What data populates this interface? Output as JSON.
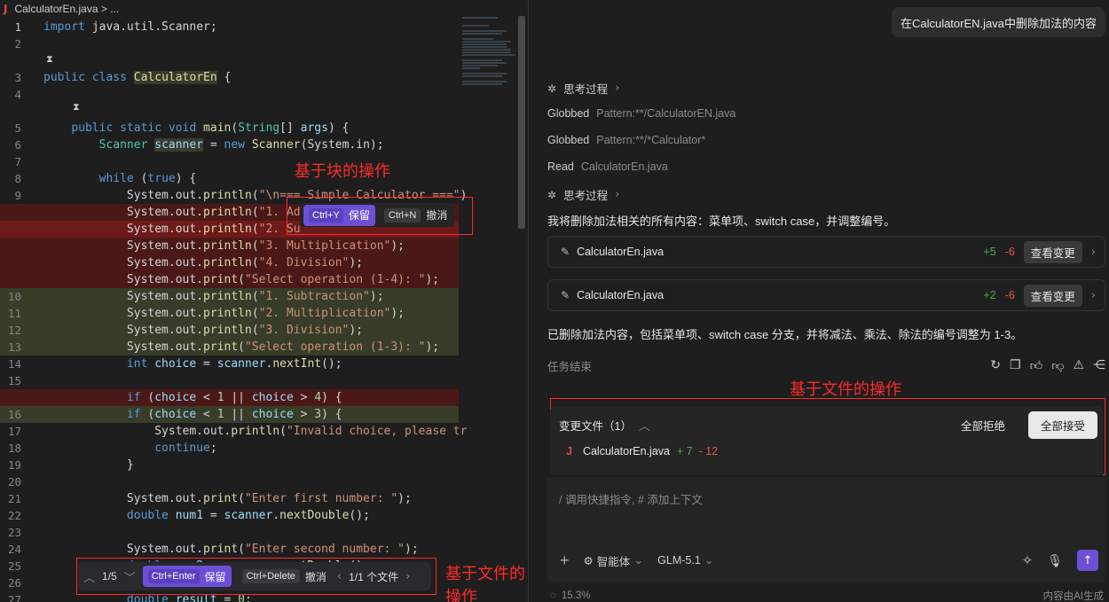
{
  "tab": {
    "icon": "J",
    "title": "CalculatorEn.java > ..."
  },
  "code": {
    "lines": [
      {
        "n": "1",
        "cls": "",
        "html": "<span class='kw'>import</span> java.util.Scanner;"
      },
      {
        "n": "2",
        "cls": "",
        "html": ""
      },
      {
        "n": "",
        "cls": "",
        "html": ""
      },
      {
        "n": "3",
        "cls": "",
        "html": "<span class='kw'>public</span> <span class='kw'>class</span> <span class='cls'>CalculatorEn</span> {"
      },
      {
        "n": "4",
        "cls": "",
        "html": ""
      },
      {
        "n": "",
        "cls": "",
        "html": ""
      },
      {
        "n": "5",
        "cls": "",
        "html": "    <span class='kw'>public</span> <span class='kw'>static</span> <span class='kw'>void</span> <span class='fn'>main</span>(<span class='ty'>String</span>[] <span class='var'>args</span>) {"
      },
      {
        "n": "6",
        "cls": "",
        "html": "        <span class='ty'>Scanner</span> <span class='hl'>scanner</span> = <span class='kw'>new</span> <span class='fn'>Scanner</span>(System.in);"
      },
      {
        "n": "7",
        "cls": "",
        "html": ""
      },
      {
        "n": "8",
        "cls": "",
        "html": "        <span class='kw'>while</span> (<span class='kw'>true</span>) {"
      },
      {
        "n": "9",
        "cls": "",
        "html": "            System.out.<span class='fn'>println</span>(<span class='str'>\"\\n=== Simple Calculator ===\"</span>)"
      },
      {
        "n": "",
        "cls": "del",
        "html": "            System.out.<span class='fn'>println</span>(<span class='str'>\"1. Ad</span>"
      },
      {
        "n": "",
        "cls": "del2",
        "html": "            System.out.<span class='fn'>println</span>(<span class='str'>\"2. Su</span>"
      },
      {
        "n": "",
        "cls": "del",
        "html": "            System.out.<span class='fn'>println</span>(<span class='str'>\"3. Multiplication\"</span>);"
      },
      {
        "n": "",
        "cls": "del",
        "html": "            System.out.<span class='fn'>println</span>(<span class='str'>\"4. Division\"</span>);"
      },
      {
        "n": "",
        "cls": "del",
        "html": "            System.out.<span class='fn'>print</span>(<span class='str'>\"Select operation (1-4): \"</span>);"
      },
      {
        "n": "10",
        "cls": "add",
        "html": "            System.out.<span class='fn'>println</span>(<span class='str'>\"1. Subtraction\"</span>);"
      },
      {
        "n": "11",
        "cls": "add",
        "html": "            System.out.<span class='fn'>println</span>(<span class='str'>\"2. Multiplication\"</span>);"
      },
      {
        "n": "12",
        "cls": "add",
        "html": "            System.out.<span class='fn'>println</span>(<span class='str'>\"3. Division\"</span>);"
      },
      {
        "n": "13",
        "cls": "add",
        "html": "            System.out.<span class='fn'>print</span>(<span class='str'>\"Select operation (1-3): \"</span>);"
      },
      {
        "n": "14",
        "cls": "",
        "html": "            <span class='kw'>int</span> <span class='var'>choice</span> = <span class='var'>scanner</span>.<span class='fn'>nextInt</span>();"
      },
      {
        "n": "15",
        "cls": "",
        "html": ""
      },
      {
        "n": "",
        "cls": "del",
        "html": "            <span class='kw'>if</span> (<span class='var'>choice</span> &lt; <span class='num'>1</span> || <span class='var'>choice</span> &gt; <span class='num'>4</span>) {"
      },
      {
        "n": "16",
        "cls": "add",
        "html": "            <span class='kw'>if</span> (<span class='var'>choice</span> &lt; <span class='num'>1</span> || <span class='var'>choice</span> &gt; <span class='num'>3</span>) {"
      },
      {
        "n": "17",
        "cls": "",
        "html": "                System.out.<span class='fn'>println</span>(<span class='str'>\"Invalid choice, please tr</span>"
      },
      {
        "n": "18",
        "cls": "",
        "html": "                <span class='kw'>continue</span>;"
      },
      {
        "n": "19",
        "cls": "",
        "html": "            }"
      },
      {
        "n": "20",
        "cls": "",
        "html": ""
      },
      {
        "n": "21",
        "cls": "",
        "html": "            System.out.<span class='fn'>print</span>(<span class='str'>\"Enter first number: \"</span>);"
      },
      {
        "n": "22",
        "cls": "",
        "html": "            <span class='kw'>double</span> <span class='var'>num1</span> = <span class='var'>scanner</span>.<span class='fn'>nextDouble</span>();"
      },
      {
        "n": "23",
        "cls": "",
        "html": ""
      },
      {
        "n": "24",
        "cls": "",
        "html": "            System.out.<span class='fn'>print</span>(<span class='str'>\"Enter second number: \"</span>);"
      },
      {
        "n": "25",
        "cls": "",
        "html": "            <span class='kw'>double</span> <span class='var'>num2</span> = <span class='var'>scanner</span>.<span class='fn'>nextDouble</span>();"
      },
      {
        "n": "26",
        "cls": "",
        "html": ""
      },
      {
        "n": "27",
        "cls": "",
        "html": "            <span class='kw'>double</span> <span class='var'>result</span> = <span class='num'>0</span>;"
      }
    ]
  },
  "annotations": {
    "block_ops": "基于块的操作",
    "file_ops_editor": "基于文件的操作",
    "file_ops_chat": "基于文件的操作"
  },
  "blockbar": {
    "keep_key": "Ctrl+Y",
    "keep_label": "保留",
    "undo_key": "Ctrl+N",
    "undo_label": "撤消"
  },
  "filebar": {
    "counter": "1/5",
    "keep_key": "Ctrl+Enter",
    "keep_label": "保留",
    "undo_key": "Ctrl+Delete",
    "undo_label": "撤消",
    "files": "1/1 个文件"
  },
  "chat": {
    "user_message": "在CalculatorEN.java中删除加法的内容",
    "thinking1": "思考过程",
    "steps": [
      {
        "verb": "Globbed",
        "detail": "Pattern:**/CalculatorEN.java"
      },
      {
        "verb": "Globbed",
        "detail": "Pattern:**/*Calculator*"
      },
      {
        "verb": "Read",
        "detail": "CalculatorEn.java"
      }
    ],
    "thinking2": "思考过程",
    "plan": "我将删除加法相关的所有内容：菜单项、switch case，并调整编号。",
    "cards": [
      {
        "file": "CalculatorEn.java",
        "plus": "+5",
        "minus": "-6",
        "action": "查看变更"
      },
      {
        "file": "CalculatorEn.java",
        "plus": "+2",
        "minus": "-6",
        "action": "查看变更"
      }
    ],
    "summary": "已删除加法内容，包括菜单项、switch case 分支，并将减法、乘法、除法的编号调整为 1-3。",
    "task_done": "任务结束",
    "changes": {
      "title": "变更文件（1）",
      "reject_all": "全部拒绝",
      "accept_all": "全部接受",
      "file": "CalculatorEn.java",
      "plus": "+ 7",
      "minus": "- 12",
      "file_icon": "J"
    },
    "input": {
      "placeholder": "/ 调用快捷指令, # 添加上下文",
      "agent": "智能体",
      "model": "GLM-5.1"
    },
    "footer": {
      "progress": "15.3%",
      "disclaimer": "内容由AI生成"
    }
  }
}
